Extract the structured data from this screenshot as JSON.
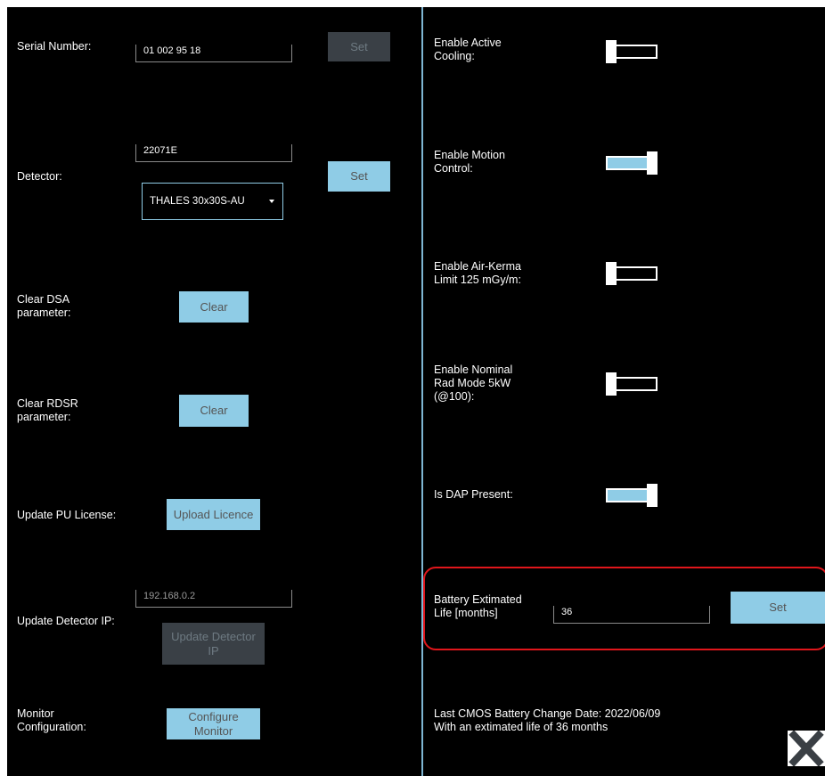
{
  "left": {
    "serial_label": "Serial Number:",
    "serial_value": "01 002 95 18",
    "serial_set": "Set",
    "detector_label": "Detector:",
    "detector_value": "22071E",
    "detector_select": "THALES 30x30S-AU",
    "detector_set": "Set",
    "clear_dsa_label": "Clear DSA\nparameter:",
    "clear_dsa_button": "Clear",
    "clear_rdsr_label": "Clear RDSR\nparameter:",
    "clear_rdsr_button": "Clear",
    "pu_license_label": "Update PU License:",
    "pu_license_button": "Upload Licence",
    "detector_ip_label": "Update Detector IP:",
    "detector_ip_value": "192.168.0.2",
    "detector_ip_button": "Update Detector\nIP",
    "monitor_label": "Monitor\nConfiguration:",
    "monitor_button": "Configure\nMonitor"
  },
  "right": {
    "active_cooling_label": "Enable Active\nCooling:",
    "active_cooling_on": false,
    "motion_control_label": "Enable Motion\nControl:",
    "motion_control_on": true,
    "air_kerma_label": "Enable Air-Kerma\nLimit 125 mGy/m:",
    "air_kerma_on": false,
    "nominal_rad_label": "Enable Nominal\nRad Mode 5kW\n(@100):",
    "nominal_rad_on": false,
    "dap_label": "Is DAP Present:",
    "dap_on": true,
    "battery_label": "Battery Extimated\nLife [months]",
    "battery_value": "36",
    "battery_set": "Set",
    "battery_info": "Last CMOS Battery Change Date: 2022/06/09\nWith an extimated life of 36 months"
  },
  "colors": {
    "accent": "#8fcce6",
    "background": "#000000",
    "highlight": "#e0161b"
  },
  "icons": {
    "close": "close-x-icon"
  }
}
